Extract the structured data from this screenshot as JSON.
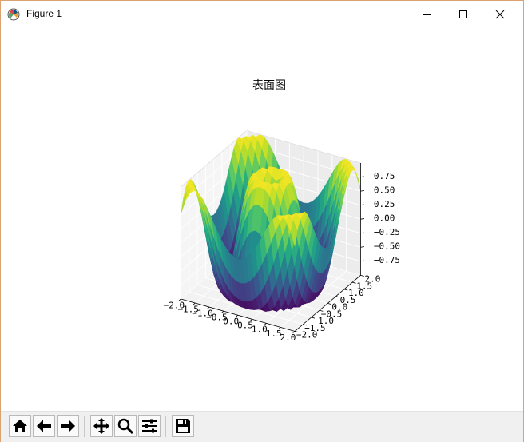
{
  "window": {
    "title": "Figure 1"
  },
  "toolbar": {
    "buttons": [
      "home",
      "back",
      "forward",
      "pan",
      "zoom",
      "configure-subplots",
      "save"
    ]
  },
  "chart_data": {
    "type": "surface3d",
    "title": "表面图",
    "colormap": "viridis",
    "function": "z = sin(pi * sqrt(x^2 + y^2))",
    "x_range": [
      -2.0,
      2.0
    ],
    "y_range": [
      -2.0,
      2.0
    ],
    "z_range": [
      -1.0,
      1.0
    ],
    "x_ticks": [
      "−2.0",
      "−1.5",
      "−1.0",
      "−0.5",
      "0.0",
      "0.5",
      "1.0",
      "1.5",
      "2.0"
    ],
    "y_ticks": [
      "−2.0",
      "−1.5",
      "−1.0",
      "−0.5",
      "0.0",
      "0.5",
      "1.0",
      "1.5",
      "2.0"
    ],
    "z_ticks": [
      "−0.75",
      "−0.50",
      "−0.25",
      "0.00",
      "0.25",
      "0.50",
      "0.75"
    ],
    "grid": true
  },
  "colors": {
    "window_border": "#d9a26f",
    "pane": "#f2f2f2"
  }
}
